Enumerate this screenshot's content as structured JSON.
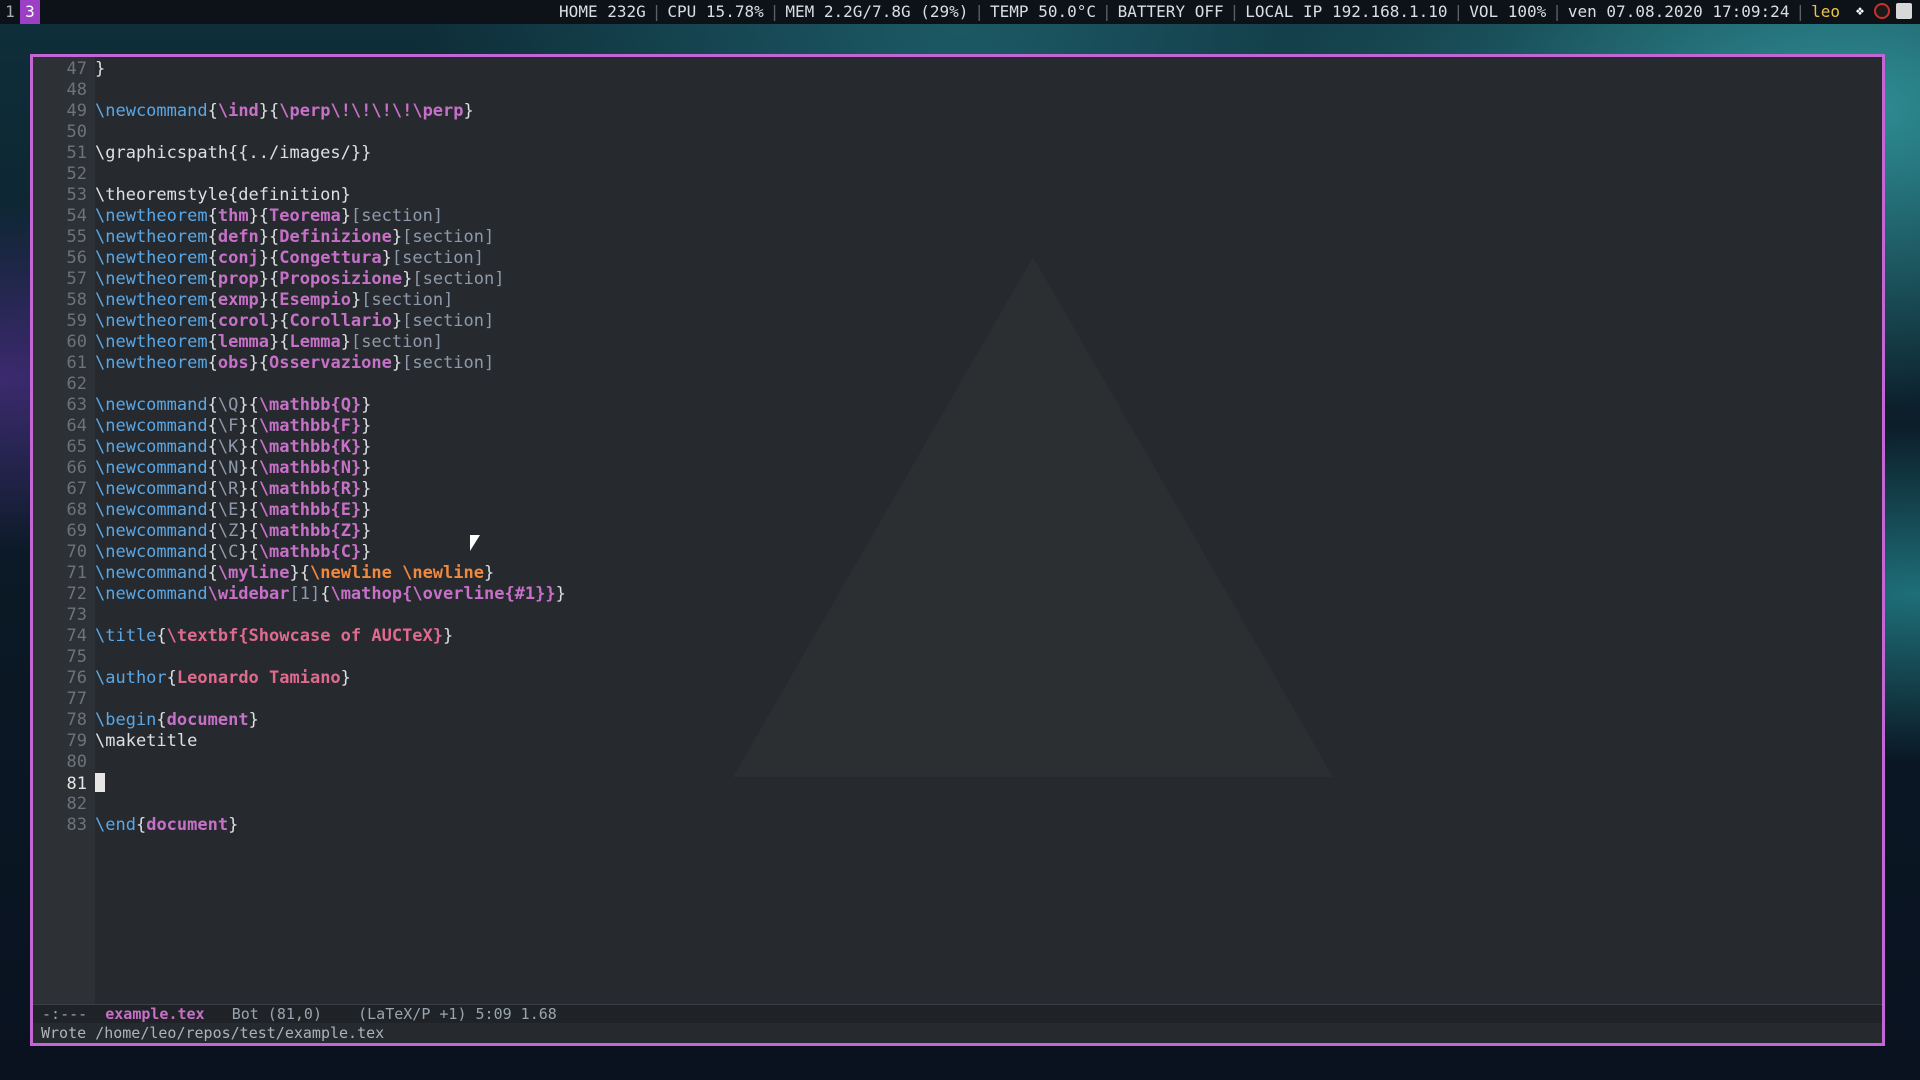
{
  "topbar": {
    "workspaces": [
      "1",
      "3"
    ],
    "active_workspace": "3",
    "home": "HOME 232G",
    "cpu": "CPU 15.78%",
    "mem": "MEM 2.2G/7.8G (29%)",
    "temp": "TEMP 50.0°C",
    "battery": "BATTERY OFF",
    "local_ip": "LOCAL IP 192.168.1.10",
    "volume": "VOL 100%",
    "datetime": "ven 07.08.2020 17:09:24",
    "user": "leo",
    "tray_icons": [
      "dropbox-icon",
      "chrome-icon",
      "window-icon"
    ]
  },
  "editor": {
    "lines": [
      {
        "n": "47",
        "parts": [
          {
            "c": "plain",
            "t": "}"
          }
        ]
      },
      {
        "n": "48",
        "parts": []
      },
      {
        "n": "49",
        "parts": [
          {
            "c": "cmd",
            "t": "\\newcommand"
          },
          {
            "c": "brace",
            "t": "{"
          },
          {
            "c": "arg",
            "t": "\\ind"
          },
          {
            "c": "brace",
            "t": "}{"
          },
          {
            "c": "arg",
            "t": "\\perp\\!\\!\\!\\!\\perp"
          },
          {
            "c": "brace",
            "t": "}"
          }
        ]
      },
      {
        "n": "50",
        "parts": []
      },
      {
        "n": "51",
        "parts": [
          {
            "c": "plain",
            "t": "\\graphicspath{{../images/}}"
          }
        ]
      },
      {
        "n": "52",
        "parts": []
      },
      {
        "n": "53",
        "parts": [
          {
            "c": "plain",
            "t": "\\theoremstyle{definition}"
          }
        ]
      },
      {
        "n": "54",
        "parts": [
          {
            "c": "cmd",
            "t": "\\newtheorem"
          },
          {
            "c": "brace",
            "t": "{"
          },
          {
            "c": "arg",
            "t": "thm"
          },
          {
            "c": "brace",
            "t": "}{"
          },
          {
            "c": "arg",
            "t": "Teorema"
          },
          {
            "c": "brace",
            "t": "}"
          },
          {
            "c": "opt",
            "t": "[section]"
          }
        ]
      },
      {
        "n": "55",
        "parts": [
          {
            "c": "cmd",
            "t": "\\newtheorem"
          },
          {
            "c": "brace",
            "t": "{"
          },
          {
            "c": "arg",
            "t": "defn"
          },
          {
            "c": "brace",
            "t": "}{"
          },
          {
            "c": "arg",
            "t": "Definizione"
          },
          {
            "c": "brace",
            "t": "}"
          },
          {
            "c": "opt",
            "t": "[section]"
          }
        ]
      },
      {
        "n": "56",
        "parts": [
          {
            "c": "cmd",
            "t": "\\newtheorem"
          },
          {
            "c": "brace",
            "t": "{"
          },
          {
            "c": "arg",
            "t": "conj"
          },
          {
            "c": "brace",
            "t": "}{"
          },
          {
            "c": "arg",
            "t": "Congettura"
          },
          {
            "c": "brace",
            "t": "}"
          },
          {
            "c": "opt",
            "t": "[section]"
          }
        ]
      },
      {
        "n": "57",
        "parts": [
          {
            "c": "cmd",
            "t": "\\newtheorem"
          },
          {
            "c": "brace",
            "t": "{"
          },
          {
            "c": "arg",
            "t": "prop"
          },
          {
            "c": "brace",
            "t": "}{"
          },
          {
            "c": "arg",
            "t": "Proposizione"
          },
          {
            "c": "brace",
            "t": "}"
          },
          {
            "c": "opt",
            "t": "[section]"
          }
        ]
      },
      {
        "n": "58",
        "parts": [
          {
            "c": "cmd",
            "t": "\\newtheorem"
          },
          {
            "c": "brace",
            "t": "{"
          },
          {
            "c": "arg",
            "t": "exmp"
          },
          {
            "c": "brace",
            "t": "}{"
          },
          {
            "c": "arg",
            "t": "Esempio"
          },
          {
            "c": "brace",
            "t": "}"
          },
          {
            "c": "opt",
            "t": "[section]"
          }
        ]
      },
      {
        "n": "59",
        "parts": [
          {
            "c": "cmd",
            "t": "\\newtheorem"
          },
          {
            "c": "brace",
            "t": "{"
          },
          {
            "c": "arg",
            "t": "corol"
          },
          {
            "c": "brace",
            "t": "}{"
          },
          {
            "c": "arg",
            "t": "Corollario"
          },
          {
            "c": "brace",
            "t": "}"
          },
          {
            "c": "opt",
            "t": "[section]"
          }
        ]
      },
      {
        "n": "60",
        "parts": [
          {
            "c": "cmd",
            "t": "\\newtheorem"
          },
          {
            "c": "brace",
            "t": "{"
          },
          {
            "c": "arg",
            "t": "lemma"
          },
          {
            "c": "brace",
            "t": "}{"
          },
          {
            "c": "arg",
            "t": "Lemma"
          },
          {
            "c": "brace",
            "t": "}"
          },
          {
            "c": "opt",
            "t": "[section]"
          }
        ]
      },
      {
        "n": "61",
        "parts": [
          {
            "c": "cmd",
            "t": "\\newtheorem"
          },
          {
            "c": "brace",
            "t": "{"
          },
          {
            "c": "arg",
            "t": "obs"
          },
          {
            "c": "brace",
            "t": "}{"
          },
          {
            "c": "arg",
            "t": "Osservazione"
          },
          {
            "c": "brace",
            "t": "}"
          },
          {
            "c": "opt",
            "t": "[section]"
          }
        ]
      },
      {
        "n": "62",
        "parts": []
      },
      {
        "n": "63",
        "parts": [
          {
            "c": "cmd",
            "t": "\\newcommand"
          },
          {
            "c": "brace",
            "t": "{"
          },
          {
            "c": "opt",
            "t": "\\Q"
          },
          {
            "c": "brace",
            "t": "}{"
          },
          {
            "c": "arg",
            "t": "\\mathbb{Q}"
          },
          {
            "c": "brace",
            "t": "}"
          }
        ]
      },
      {
        "n": "64",
        "parts": [
          {
            "c": "cmd",
            "t": "\\newcommand"
          },
          {
            "c": "brace",
            "t": "{"
          },
          {
            "c": "opt",
            "t": "\\F"
          },
          {
            "c": "brace",
            "t": "}{"
          },
          {
            "c": "arg",
            "t": "\\mathbb{F}"
          },
          {
            "c": "brace",
            "t": "}"
          }
        ]
      },
      {
        "n": "65",
        "parts": [
          {
            "c": "cmd",
            "t": "\\newcommand"
          },
          {
            "c": "brace",
            "t": "{"
          },
          {
            "c": "opt",
            "t": "\\K"
          },
          {
            "c": "brace",
            "t": "}{"
          },
          {
            "c": "arg",
            "t": "\\mathbb{K}"
          },
          {
            "c": "brace",
            "t": "}"
          }
        ]
      },
      {
        "n": "66",
        "parts": [
          {
            "c": "cmd",
            "t": "\\newcommand"
          },
          {
            "c": "brace",
            "t": "{"
          },
          {
            "c": "opt",
            "t": "\\N"
          },
          {
            "c": "brace",
            "t": "}{"
          },
          {
            "c": "arg",
            "t": "\\mathbb{N}"
          },
          {
            "c": "brace",
            "t": "}"
          }
        ]
      },
      {
        "n": "67",
        "parts": [
          {
            "c": "cmd",
            "t": "\\newcommand"
          },
          {
            "c": "brace",
            "t": "{"
          },
          {
            "c": "opt",
            "t": "\\R"
          },
          {
            "c": "brace",
            "t": "}{"
          },
          {
            "c": "arg",
            "t": "\\mathbb{R}"
          },
          {
            "c": "brace",
            "t": "}"
          }
        ]
      },
      {
        "n": "68",
        "parts": [
          {
            "c": "cmd",
            "t": "\\newcommand"
          },
          {
            "c": "brace",
            "t": "{"
          },
          {
            "c": "opt",
            "t": "\\E"
          },
          {
            "c": "brace",
            "t": "}{"
          },
          {
            "c": "arg",
            "t": "\\mathbb{E}"
          },
          {
            "c": "brace",
            "t": "}"
          }
        ]
      },
      {
        "n": "69",
        "parts": [
          {
            "c": "cmd",
            "t": "\\newcommand"
          },
          {
            "c": "brace",
            "t": "{"
          },
          {
            "c": "opt",
            "t": "\\Z"
          },
          {
            "c": "brace",
            "t": "}{"
          },
          {
            "c": "arg",
            "t": "\\mathbb{Z}"
          },
          {
            "c": "brace",
            "t": "}"
          }
        ]
      },
      {
        "n": "70",
        "parts": [
          {
            "c": "cmd",
            "t": "\\newcommand"
          },
          {
            "c": "brace",
            "t": "{"
          },
          {
            "c": "opt",
            "t": "\\C"
          },
          {
            "c": "brace",
            "t": "}{"
          },
          {
            "c": "arg",
            "t": "\\mathbb{C}"
          },
          {
            "c": "brace",
            "t": "}"
          }
        ]
      },
      {
        "n": "71",
        "parts": [
          {
            "c": "cmd",
            "t": "\\newcommand"
          },
          {
            "c": "brace",
            "t": "{"
          },
          {
            "c": "arg",
            "t": "\\myline"
          },
          {
            "c": "brace",
            "t": "}{"
          },
          {
            "c": "nl",
            "t": "\\newline \\newline"
          },
          {
            "c": "brace",
            "t": "}"
          }
        ]
      },
      {
        "n": "72",
        "parts": [
          {
            "c": "cmd",
            "t": "\\newcommand"
          },
          {
            "c": "arg",
            "t": "\\widebar"
          },
          {
            "c": "opt",
            "t": "[1]"
          },
          {
            "c": "brace",
            "t": "{"
          },
          {
            "c": "arg",
            "t": "\\mathop{\\overline{#1}}"
          },
          {
            "c": "brace",
            "t": "}"
          }
        ]
      },
      {
        "n": "73",
        "parts": []
      },
      {
        "n": "74",
        "parts": [
          {
            "c": "cmd",
            "t": "\\title"
          },
          {
            "c": "brace",
            "t": "{"
          },
          {
            "c": "str",
            "t": "\\textbf{Showcase of AUCTeX}"
          },
          {
            "c": "brace",
            "t": "}"
          }
        ]
      },
      {
        "n": "75",
        "parts": []
      },
      {
        "n": "76",
        "parts": [
          {
            "c": "cmd",
            "t": "\\author"
          },
          {
            "c": "brace",
            "t": "{"
          },
          {
            "c": "str",
            "t": "Leonardo Tamiano"
          },
          {
            "c": "brace",
            "t": "}"
          }
        ]
      },
      {
        "n": "77",
        "parts": []
      },
      {
        "n": "78",
        "parts": [
          {
            "c": "cmd",
            "t": "\\begin"
          },
          {
            "c": "brace",
            "t": "{"
          },
          {
            "c": "arg",
            "t": "document"
          },
          {
            "c": "brace",
            "t": "}"
          }
        ]
      },
      {
        "n": "79",
        "parts": [
          {
            "c": "plain",
            "t": "\\maketitle"
          }
        ]
      },
      {
        "n": "80",
        "parts": []
      },
      {
        "n": "81",
        "parts": [],
        "cursor": true
      },
      {
        "n": "82",
        "parts": []
      },
      {
        "n": "83",
        "parts": [
          {
            "c": "cmd",
            "t": "\\end"
          },
          {
            "c": "brace",
            "t": "{"
          },
          {
            "c": "arg",
            "t": "document"
          },
          {
            "c": "brace",
            "t": "}"
          }
        ]
      }
    ]
  },
  "modeline": {
    "state": "-:---",
    "filename": "example.tex",
    "position": "Bot (81,0)",
    "mode": "(LaTeX/P +1) 5:09 1.68"
  },
  "echo_area": {
    "message": "Wrote /home/leo/repos/test/example.tex"
  }
}
